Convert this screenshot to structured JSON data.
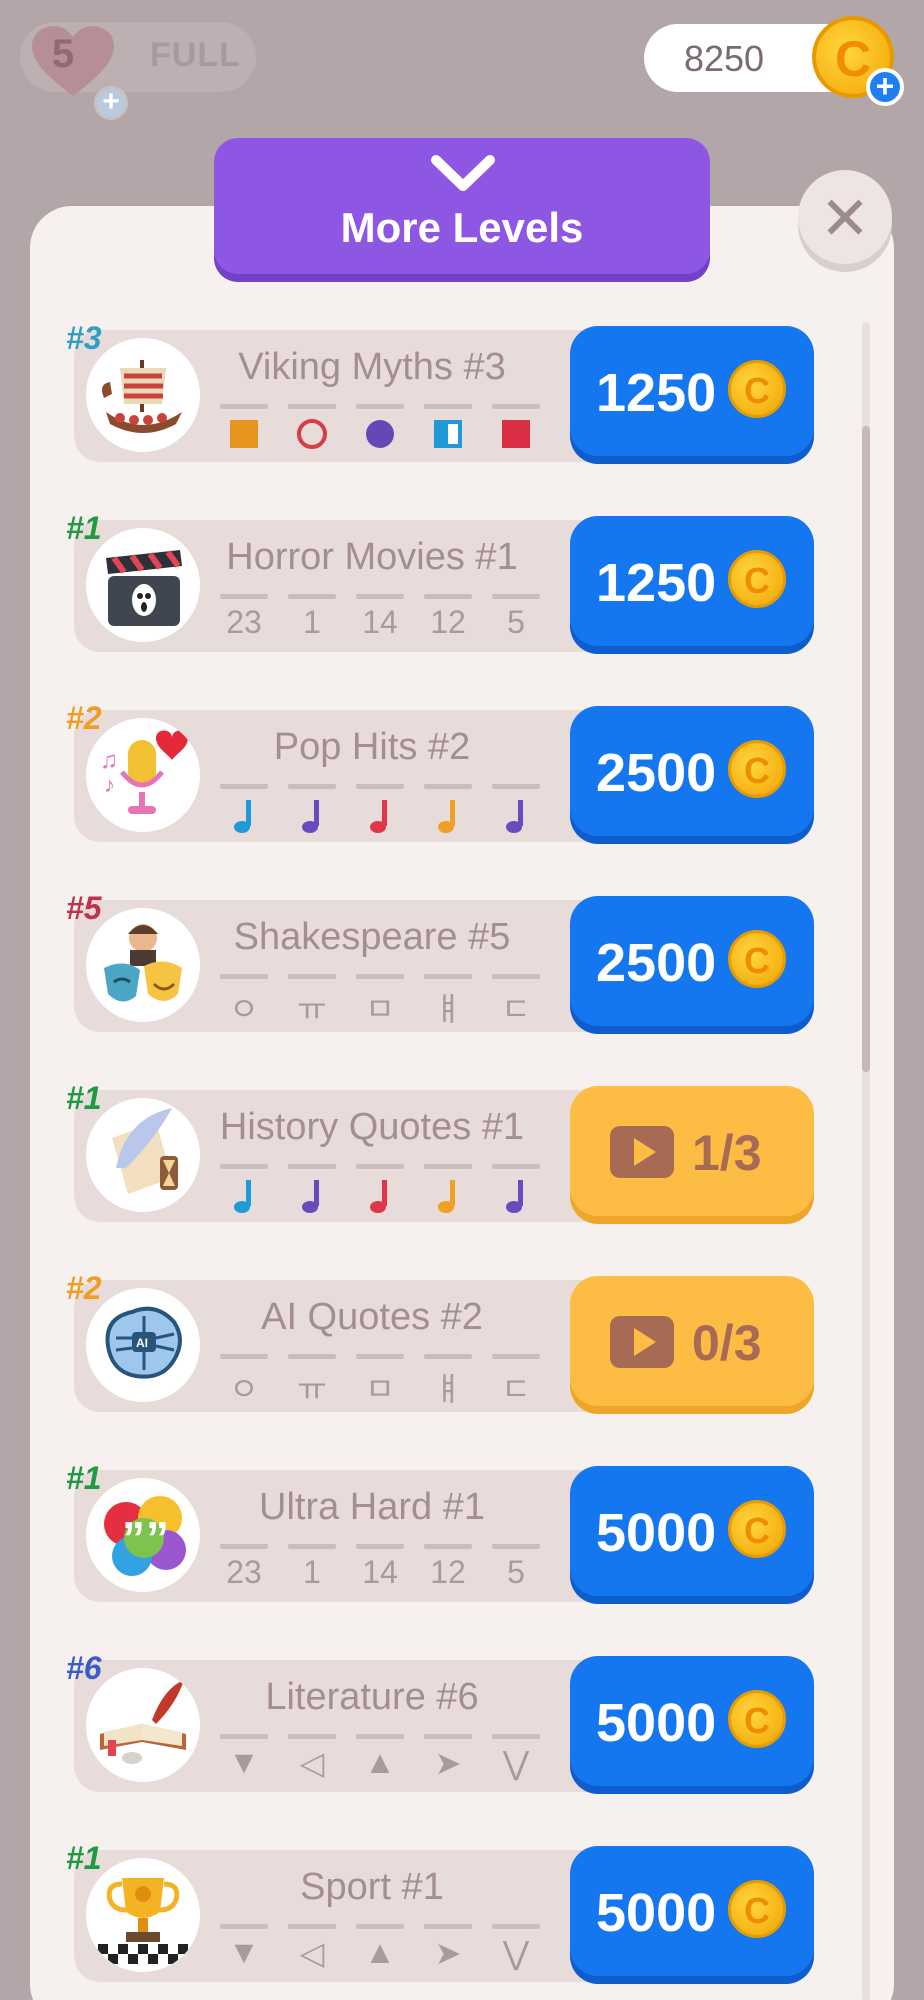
{
  "lives": {
    "count": "5",
    "status": "FULL"
  },
  "coins": {
    "amount": "8250"
  },
  "header": {
    "title": "More Levels"
  },
  "levels": [
    {
      "rank": "#3",
      "rank_color": "#2f9fc4",
      "title": "Viking Myths #3",
      "symbol_type": "shapes",
      "symbols": [
        "square-orange",
        "ring-red",
        "dot-purple",
        "half-square-blue",
        "square-red"
      ],
      "cost_type": "coins",
      "cost": "1250",
      "avatar": "viking-ship-icon"
    },
    {
      "rank": "#1",
      "rank_color": "#1f9a41",
      "title": "Horror Movies #1",
      "symbol_type": "text",
      "symbols": [
        "23",
        "1",
        "14",
        "12",
        "5"
      ],
      "cost_type": "coins",
      "cost": "1250",
      "avatar": "clapperboard-icon"
    },
    {
      "rank": "#2",
      "rank_color": "#f19c22",
      "title": "Pop Hits #2",
      "symbol_type": "notes",
      "symbols": [
        "note-blue",
        "note-purple",
        "note-red",
        "note-orange",
        "note-purple"
      ],
      "cost_type": "coins",
      "cost": "2500",
      "avatar": "microphone-icon"
    },
    {
      "rank": "#5",
      "rank_color": "#c0334d",
      "title": "Shakespeare #5",
      "symbol_type": "text",
      "symbols": [
        "ㅇ",
        "ㅠ",
        "ㅁ",
        "ㅒ",
        "ㄷ"
      ],
      "cost_type": "coins",
      "cost": "2500",
      "avatar": "theater-masks-icon"
    },
    {
      "rank": "#1",
      "rank_color": "#1f9a41",
      "title": "History Quotes #1",
      "symbol_type": "notes",
      "symbols": [
        "note-blue",
        "note-purple",
        "note-red",
        "note-orange",
        "note-purple"
      ],
      "cost_type": "ad",
      "cost": "1/3",
      "avatar": "quill-scroll-icon"
    },
    {
      "rank": "#2",
      "rank_color": "#f19c22",
      "title": "AI Quotes #2",
      "symbol_type": "text",
      "symbols": [
        "ㅇ",
        "ㅠ",
        "ㅁ",
        "ㅒ",
        "ㄷ"
      ],
      "cost_type": "ad",
      "cost": "0/3",
      "avatar": "ai-brain-icon"
    },
    {
      "rank": "#1",
      "rank_color": "#1f9a41",
      "title": "Ultra Hard #1",
      "symbol_type": "text",
      "symbols": [
        "23",
        "1",
        "14",
        "12",
        "5"
      ],
      "cost_type": "coins",
      "cost": "5000",
      "avatar": "quote-bubbles-icon"
    },
    {
      "rank": "#6",
      "rank_color": "#3a5cc8",
      "title": "Literature #6",
      "symbol_type": "arrows",
      "symbols": [
        "▼",
        "◁",
        "▲",
        "➤",
        "⋁"
      ],
      "cost_type": "coins",
      "cost": "5000",
      "avatar": "book-quill-icon"
    },
    {
      "rank": "#1",
      "rank_color": "#1f9a41",
      "title": "Sport #1",
      "symbol_type": "arrows",
      "symbols": [
        "▼",
        "◁",
        "▲",
        "➤",
        "⋁"
      ],
      "cost_type": "coins",
      "cost": "5000",
      "avatar": "trophy-icon"
    }
  ]
}
